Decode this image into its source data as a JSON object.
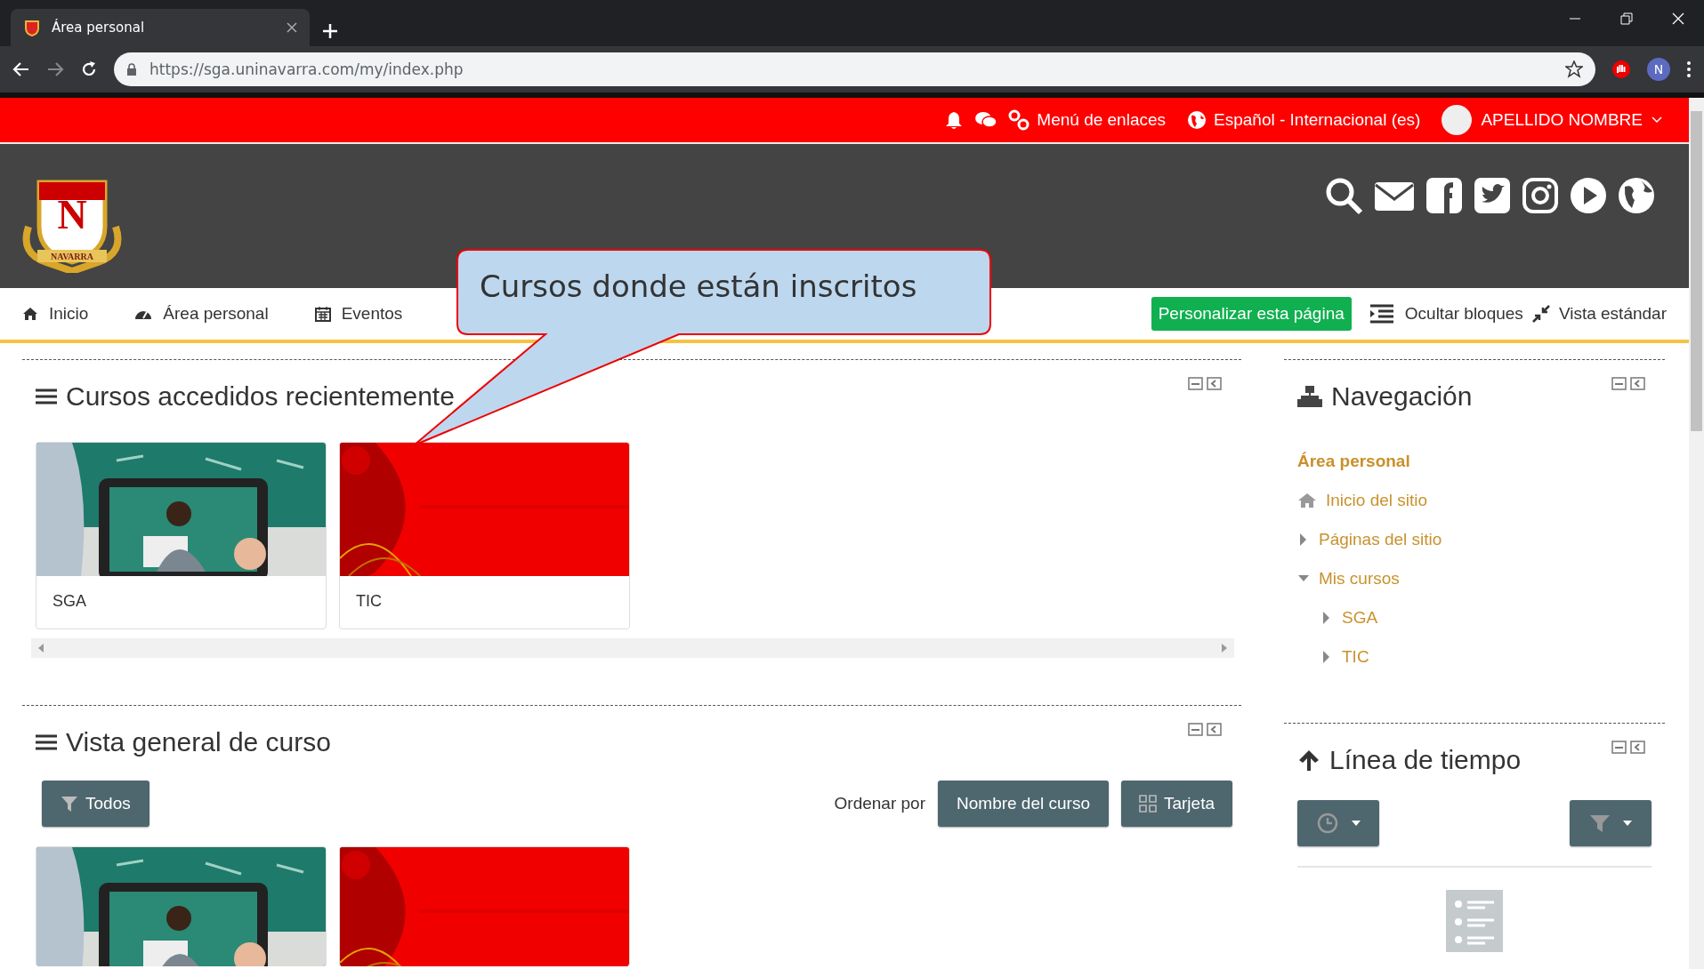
{
  "browser": {
    "tab_title": "Área personal",
    "url": "https://sga.uninavarra.com/my/index.php",
    "profile_letter": "N"
  },
  "top_bar": {
    "menu_links": "Menú de enlaces",
    "language": "Español - Internacional (es)",
    "user": "APELLIDO NOMBRE"
  },
  "logo": {
    "letter": "N",
    "banner": "NAVARRA"
  },
  "nav": {
    "items": [
      {
        "label": "Inicio",
        "kind": "home"
      },
      {
        "label": "Área personal",
        "kind": "dashboard"
      },
      {
        "label": "Eventos",
        "kind": "calendar"
      }
    ],
    "customize": "Personalizar esta página",
    "hide_blocks": "Ocultar bloques",
    "standard_view": "Vista estándar"
  },
  "callout": {
    "text": "Cursos donde están inscritos"
  },
  "recent": {
    "title": "Cursos accedidos recientemente",
    "courses": [
      {
        "name": "SGA"
      },
      {
        "name": "TIC"
      }
    ]
  },
  "overview": {
    "title": "Vista general de curso",
    "filter": "Todos",
    "sort_label": "Ordenar por",
    "sort": "Nombre del curso",
    "view": "Tarjeta"
  },
  "navigation": {
    "title": "Navegación",
    "items": [
      {
        "label": "Área personal",
        "kind": "heading"
      },
      {
        "label": "Inicio del sitio",
        "kind": "home"
      },
      {
        "label": "Páginas del sitio",
        "kind": "branch",
        "expanded": false
      },
      {
        "label": "Mis cursos",
        "kind": "branch",
        "expanded": true,
        "children": [
          {
            "label": "SGA",
            "kind": "branch",
            "expanded": false
          },
          {
            "label": "TIC",
            "kind": "branch",
            "expanded": false
          }
        ]
      }
    ]
  },
  "timeline": {
    "title": "Línea de tiempo"
  }
}
